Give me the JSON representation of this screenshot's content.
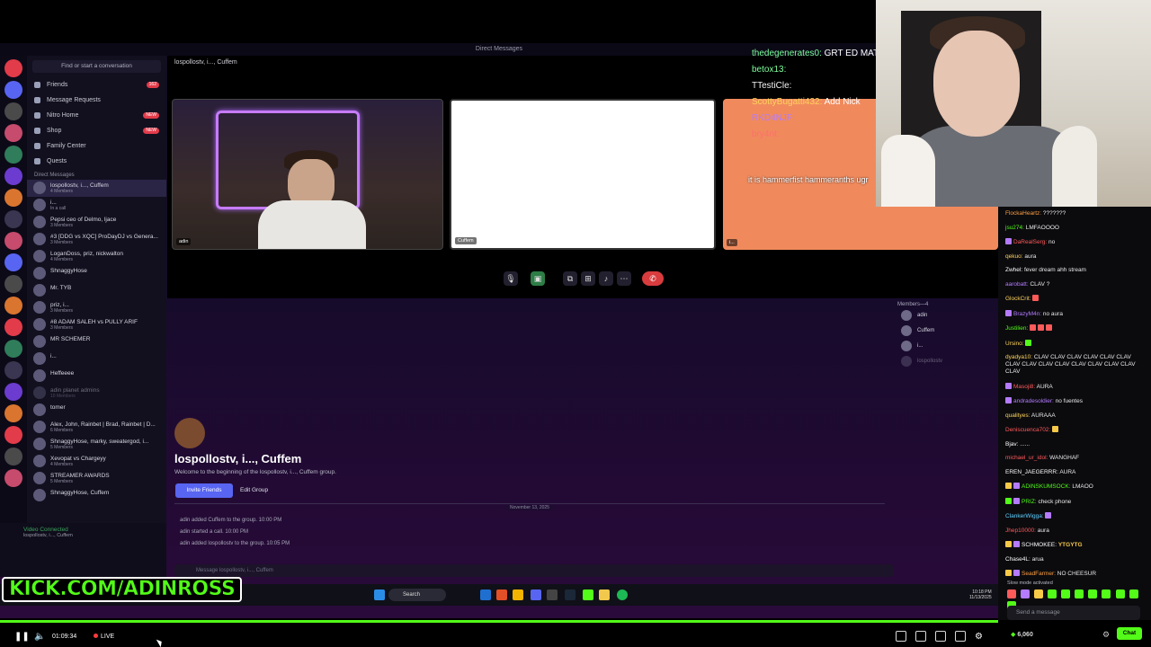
{
  "discord": {
    "window_title": "Direct Messages",
    "search_placeholder": "Find or start a conversation",
    "nav": [
      {
        "label": "Friends",
        "badge": "162"
      },
      {
        "label": "Message Requests",
        "badge": ""
      },
      {
        "label": "Nitro Home",
        "badge": "NEW"
      },
      {
        "label": "Shop",
        "badge": "NEW"
      },
      {
        "label": "Family Center",
        "badge": ""
      },
      {
        "label": "Quests",
        "badge": ""
      }
    ],
    "dm_header": "Direct Messages",
    "dms": [
      {
        "name": "lospollostv, i..., Cuffem",
        "sub": "4 Members"
      },
      {
        "name": "i...",
        "sub": "In a call"
      },
      {
        "name": "Pepsi ceo of Delmo, ljace",
        "sub": "3 Members"
      },
      {
        "name": "#3 [DDG vs XQC] ProDayDJ vs Genera...",
        "sub": "3 Members"
      },
      {
        "name": "LoganDoss, priz, nickwalton",
        "sub": "4 Members"
      },
      {
        "name": "ShnaggyHose",
        "sub": ""
      },
      {
        "name": "Mr. TYB",
        "sub": ""
      },
      {
        "name": "priz, i...",
        "sub": "3 Members"
      },
      {
        "name": "#8 ADAM SALEH vs PULLY ARIF",
        "sub": "3 Members"
      },
      {
        "name": "MR SCHEMER",
        "sub": ""
      },
      {
        "name": "i...",
        "sub": ""
      },
      {
        "name": "Heffeeee",
        "sub": ""
      },
      {
        "name": "adin planet admins",
        "sub": "10 Members"
      },
      {
        "name": "tomer",
        "sub": ""
      },
      {
        "name": "Alex, John, Rainbet | Brad, Rainbet | D...",
        "sub": "6 Members"
      },
      {
        "name": "ShnaggyHose, marky, sweatergod, i...",
        "sub": "5 Members"
      },
      {
        "name": "Xevopat vs Chargeyy",
        "sub": "4 Members"
      },
      {
        "name": "STREAMER AWARDS",
        "sub": "5 Members"
      },
      {
        "name": "ShnaggyHose, Cuffem",
        "sub": ""
      }
    ],
    "voice_status": "Video Connected",
    "voice_channel": "lospollostv, i..., Cuffem",
    "call_title": "lospollostv, i..., Cuffem",
    "tiles": [
      {
        "label": "adin"
      },
      {
        "label": "Cuffem"
      },
      {
        "label": "i..."
      }
    ],
    "welcome_title": "lospollostv, i..., Cuffem",
    "welcome_sub": "Welcome to the beginning of the lospollostv, i..., Cuffem group.",
    "invite_label": "Invite Friends",
    "edit_label": "Edit Group",
    "date_sep": "November 13, 2025",
    "system_messages": [
      "adin added Cuffem to the group. 10:00 PM",
      "adin started a call. 10:00 PM",
      "adin added lospollostv to the group. 10:05 PM"
    ],
    "message_placeholder": "Message lospollostv, i..., Cuffem",
    "members_header": "Members—4",
    "members": [
      {
        "name": "adin",
        "sub": "In a call"
      },
      {
        "name": "Cuffem",
        "sub": "In a call"
      },
      {
        "name": "i...",
        "sub": "In a call"
      },
      {
        "name": "lospollostv",
        "sub": ""
      }
    ],
    "taskbar_search": "Search",
    "clock": "10:18 PM\n11/13/2025"
  },
  "overlay_chat": [
    {
      "user": "thedegenerates0:",
      "text": "GRT ED MAT"
    },
    {
      "user": "betox13:",
      "text": ""
    },
    {
      "user": "TTestiCle:",
      "text": ""
    },
    {
      "user": "ScottyBugatti432:",
      "text": "Add Nick"
    },
    {
      "user": "RKD4NJF:",
      "text": ""
    },
    {
      "user": "bry4nt:",
      "text": ""
    }
  ],
  "overlay_text": "it is hammerfist hammeranths ugr",
  "kick_logo": "KICK.COM/ADINROSS",
  "chat": [
    {
      "user": "FlockaHeartz:",
      "text": "???????"
    },
    {
      "user": "jsu274:",
      "text": "LMFAOOOO"
    },
    {
      "user": "DaRealSerg:",
      "text": "no"
    },
    {
      "user": "qekuo:",
      "text": "aura"
    },
    {
      "user": "Zwhel:",
      "text": "fever dream ahh stream"
    },
    {
      "user": "aarobatt:",
      "text": "CLAV ?"
    },
    {
      "user": "GlockCrit:",
      "text": ""
    },
    {
      "user": "BrazyM4n:",
      "text": "no aura"
    },
    {
      "user": "Justilien:",
      "text": ""
    },
    {
      "user": "Ursino:",
      "text": ""
    },
    {
      "user": "dyadya10:",
      "text": "CLAV CLAV CLAV CLAV CLAV CLAV CLAV CLAV CLAV CLAV CLAV CLAV CLAV CLAV CLAV"
    },
    {
      "user": "Masoji8:",
      "text": "AURA"
    },
    {
      "user": "andradesoldier:",
      "text": "no fuentes"
    },
    {
      "user": "qualityes:",
      "text": "AURAAA"
    },
    {
      "user": "Deniscuenca702:",
      "text": ""
    },
    {
      "user": "Bjav:",
      "text": "......"
    },
    {
      "user": "michael_ur_idol:",
      "text": "WANGHAF"
    },
    {
      "user": "EREN_JAEGERRR:",
      "text": "AURA"
    },
    {
      "user": "ADINSKUMSOCK:",
      "text": "LMAOO"
    },
    {
      "user": "PRIZ:",
      "text": "check phone"
    },
    {
      "user": "ClankerWigga:",
      "text": ""
    },
    {
      "user": "Jhep10000:",
      "text": "aura"
    },
    {
      "user": "SCHMOKEE:",
      "text": "YTGYTG"
    },
    {
      "user": "Chase4L:",
      "text": "arua"
    },
    {
      "user": "SeadFarmer:",
      "text": "NO CHEESUR"
    }
  ],
  "slow_mode": "Slow mode activated",
  "chat_placeholder": "Send a message",
  "viewer_count": "6,060",
  "chat_button": "Chat",
  "player": {
    "time": "01:09:34",
    "live": "LIVE"
  }
}
